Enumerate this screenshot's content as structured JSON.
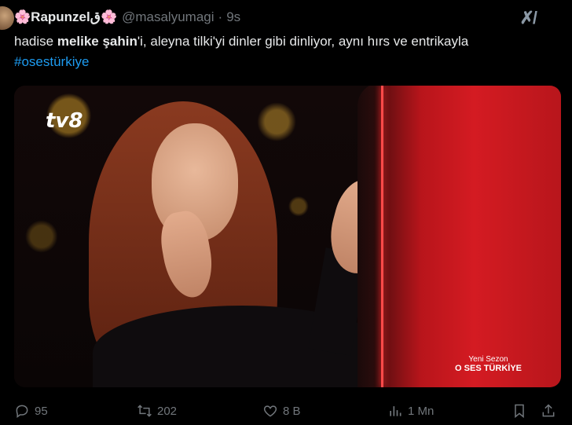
{
  "author": {
    "display_name": "🌸Rapunzelق🌸",
    "handle": "@masalyumagi",
    "separator": "·",
    "time": "9s"
  },
  "tweet": {
    "text_prefix": "hadise ",
    "mention_bold": "melike şahin",
    "text_middle": "'i, aleyna tilki'yi dinler gibi dinliyor, aynı hırs ve entrikayla ",
    "hashtag": "#osestürkiye"
  },
  "media": {
    "channel_logo": "tv8",
    "caption_sub": "Yeni Sezon",
    "caption_main": "O SES TÜRKİYE"
  },
  "actions": {
    "replies": "95",
    "retweets": "202",
    "likes": "8 B",
    "views": "1 Mn"
  },
  "icons": [
    "grok-icon",
    "more-icon",
    "reply-icon",
    "retweet-icon",
    "like-icon",
    "views-icon",
    "bookmark-icon",
    "share-icon"
  ],
  "colors": {
    "background": "#000000",
    "text": "#e7e9ea",
    "muted": "#71767b",
    "link": "#1d9bf0",
    "chair": "#d41b22"
  }
}
